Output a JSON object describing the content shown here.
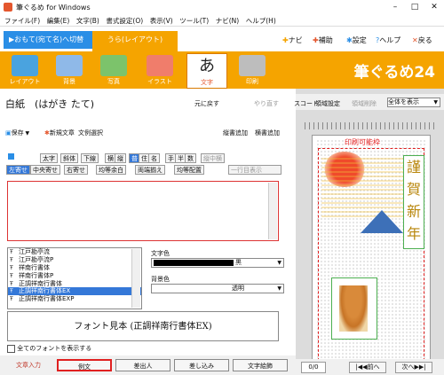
{
  "window": {
    "title": "筆ぐるめ for Windows",
    "minimize": "–",
    "maximize": "□",
    "close": "✕"
  },
  "menu": [
    "ファイル(F)",
    "編集(E)",
    "文字(B)",
    "書式設定(O)",
    "表示(V)",
    "ツール(T)",
    "ナビ(N)",
    "ヘルプ(H)"
  ],
  "tabs": {
    "front_label": "▶おもて(宛て名)へ切替",
    "back_label": "うら(レイアウト)"
  },
  "toplinks": {
    "navi": "ナビ",
    "hokan": "補助",
    "settings": "設定",
    "help": "ヘルプ",
    "back": "戻る"
  },
  "ribbon": {
    "items": [
      {
        "label": "レイアウト",
        "icon": "layout-icon",
        "color": "#4aa3df"
      },
      {
        "label": "背景",
        "icon": "background-icon",
        "color": "#8fb9e8"
      },
      {
        "label": "写真",
        "icon": "photo-icon",
        "color": "#7cc36b"
      },
      {
        "label": "イラスト",
        "icon": "illustration-icon",
        "color": "#f07d6b"
      },
      {
        "label": "文字",
        "icon": "text-icon",
        "color": "#e4572e"
      },
      {
        "label": "印刷",
        "icon": "print-icon",
        "color": "#bdbdbd"
      }
    ],
    "active_label": "文字",
    "logo": "筆ぐるめ24"
  },
  "left_panel": {
    "paper_name": "白紙　(はがき たて)",
    "undo": "元に戻す",
    "redo": "やり直す",
    "save": "保存",
    "new_text": "新規文章",
    "select_example": "文例選択",
    "vertical_add": "縦書追加",
    "horizontal_add": "横書追加",
    "toolbar1": [
      "太字",
      "斜体",
      "下線",
      "横",
      "縦",
      "普",
      "住",
      "名",
      "手",
      "半",
      "数",
      "縦中横"
    ],
    "toolbar2": [
      "左寄せ",
      "中央寄せ",
      "右寄せ",
      "均等余白",
      "両端揃え",
      "均等配置",
      "一行目表示"
    ],
    "fonts": [
      "江戸勘亭流",
      "江戸勘亭流P",
      "祥南行書体",
      "祥南行書体P",
      "正調祥南行書体",
      "正調祥南行書体EX",
      "正調祥南行書体EXP"
    ],
    "selected_font": "正調祥南行書体EX",
    "text_color_label": "文字色",
    "text_color_value": "黒",
    "bg_color_label": "背景色",
    "bg_color_value": "透明",
    "font_sample": "フォント見本 (正調祥南行書体EX)",
    "show_all_fonts": "全てのフォントを表示する",
    "bottom_tabs": [
      "文章入力",
      "例文",
      "差出人",
      "差し込み",
      "文字絵飾"
    ]
  },
  "right_panel": {
    "record_label": "スコード",
    "area_settings": "領域設定",
    "area_delete": "領域削除",
    "view_select": "全体を表示",
    "printable_label": "印刷可能枠",
    "greeting": [
      "謹",
      "賀",
      "新",
      "年"
    ],
    "page_count": "0/0",
    "prev": "前へ",
    "next": "次へ"
  },
  "colors": {
    "accent_orange": "#f5a400",
    "accent_blue": "#2a8ee6",
    "highlight_red": "#e02020"
  }
}
